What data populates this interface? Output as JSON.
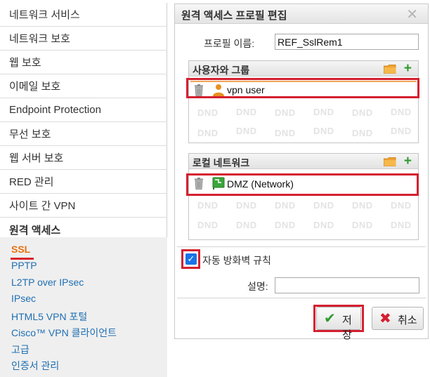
{
  "sidebar": {
    "items": [
      {
        "label": "네트워크 서비스"
      },
      {
        "label": "네트워크 보호"
      },
      {
        "label": "웹 보호"
      },
      {
        "label": "이메일 보호"
      },
      {
        "label": "Endpoint Protection"
      },
      {
        "label": "무선 보호"
      },
      {
        "label": "웹 서버 보호"
      },
      {
        "label": "RED 관리"
      },
      {
        "label": "사이트 간 VPN"
      },
      {
        "label": "원격 액세스"
      }
    ],
    "subitems": [
      {
        "label": "SSL"
      },
      {
        "label": "PPTP"
      },
      {
        "label": "L2TP over IPsec"
      },
      {
        "label": "IPsec"
      },
      {
        "label": "HTML5 VPN 포털"
      },
      {
        "label": "Cisco™ VPN 클라이언트"
      },
      {
        "label": "고급"
      },
      {
        "label": "인증서 관리"
      }
    ]
  },
  "dialog": {
    "title": "원격 액세스 프로필 편집",
    "close_glyph": "✕",
    "profile_name_label": "프로필 이름:",
    "profile_name_value": "REF_SslRem1",
    "users_groups": {
      "title": "사용자와 그룹",
      "entries": [
        {
          "label": "vpn user",
          "icon": "user-icon"
        }
      ]
    },
    "local_networks": {
      "title": "로컬 네트워크",
      "entries": [
        {
          "label": "DMZ (Network)",
          "icon": "network-icon"
        }
      ]
    },
    "dnd_text": "DND",
    "auto_firewall_label": "자동 방화벽 규칙",
    "auto_firewall_checked": true,
    "comment_label": "설명:",
    "comment_value": "",
    "save_label": "저장",
    "cancel_label": "취소"
  },
  "colors": {
    "accent_red": "#d42030",
    "active_orange": "#e8700e",
    "link_blue": "#1f6fb2",
    "add_green": "#2f9a2f"
  }
}
